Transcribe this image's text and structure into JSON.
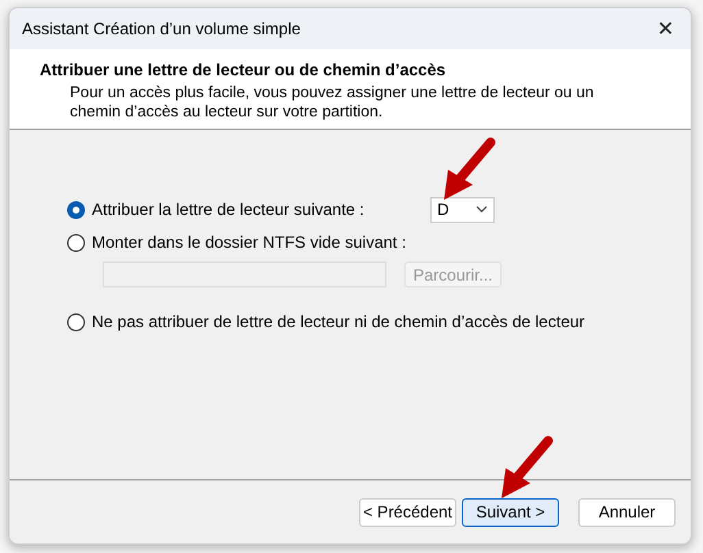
{
  "window": {
    "title": "Assistant Création d’un volume simple",
    "close": "✕"
  },
  "header": {
    "title": "Attribuer une lettre de lecteur ou de chemin d’accès",
    "description": "Pour un accès plus facile, vous pouvez assigner une lettre de lecteur ou un chemin d’accès au lecteur sur votre partition."
  },
  "options": [
    {
      "kind": "letter",
      "label": "Attribuer la lettre de lecteur suivante :",
      "selected": true,
      "value": "D"
    },
    {
      "kind": "folder",
      "label": "Monter dans le dossier NTFS vide suivant :",
      "selected": false,
      "button": "Parcourir...",
      "disabled": true
    },
    {
      "kind": "plain",
      "label": "Ne pas attribuer de lettre de lecteur ni de chemin d’accès de lecteur",
      "selected": false
    }
  ],
  "buttons": [
    {
      "label": "< Précédent",
      "default": false
    },
    {
      "label": "Suivant >",
      "default": true
    },
    {
      "label": "Annuler",
      "default": false
    }
  ],
  "annotations": [
    {
      "kind": "arrow"
    },
    {
      "kind": "arrow"
    }
  ]
}
